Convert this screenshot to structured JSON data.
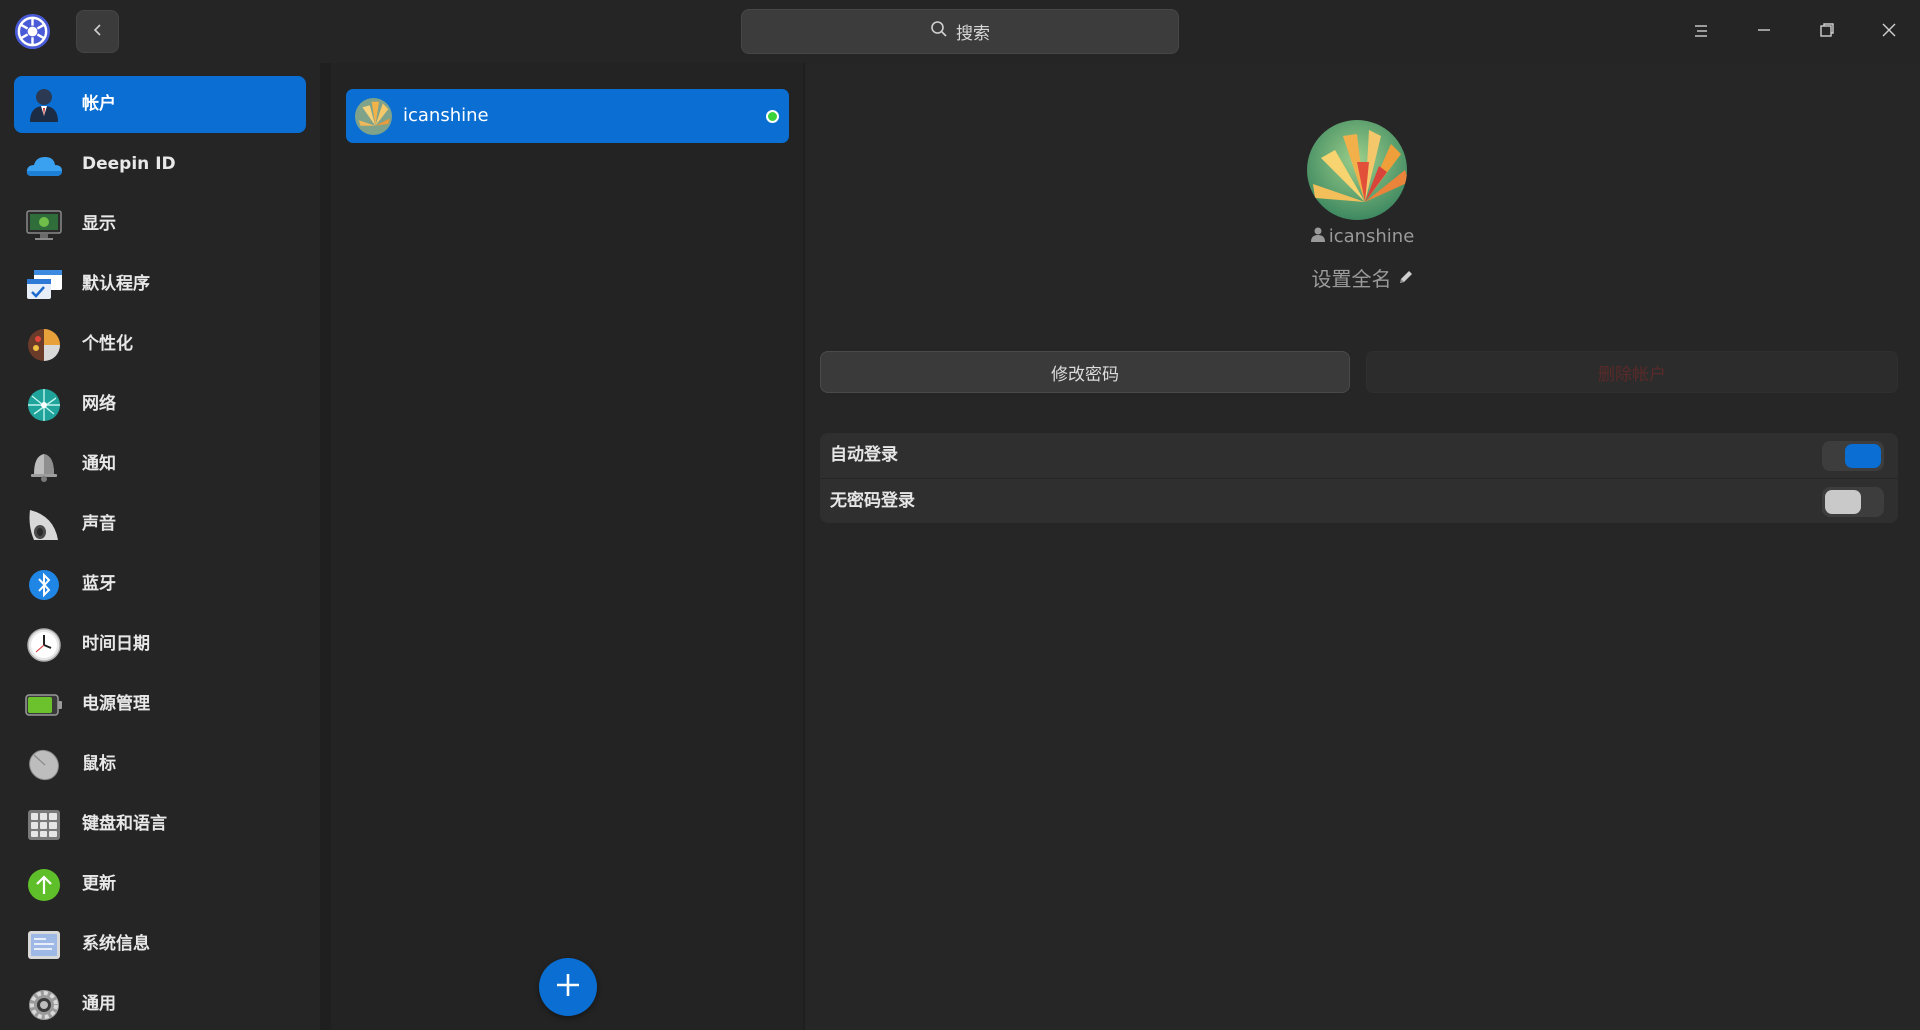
{
  "window": {
    "search_placeholder": "搜索",
    "icons": {
      "app": "settings-gear-icon",
      "back": "chevron-left-icon",
      "search": "search-icon",
      "menu": "menu-icon",
      "minimize": "minimize-icon",
      "maximize": "restore-icon",
      "close": "close-icon"
    }
  },
  "sidebar": {
    "active_index": 0,
    "items": [
      {
        "label": "帐户",
        "icon": "account-icon"
      },
      {
        "label": "Deepin ID",
        "icon": "cloud-icon"
      },
      {
        "label": "显示",
        "icon": "display-icon"
      },
      {
        "label": "默认程序",
        "icon": "default-apps-icon"
      },
      {
        "label": "个性化",
        "icon": "personalization-icon"
      },
      {
        "label": "网络",
        "icon": "network-icon"
      },
      {
        "label": "通知",
        "icon": "bell-icon"
      },
      {
        "label": "声音",
        "icon": "speaker-icon"
      },
      {
        "label": "蓝牙",
        "icon": "bluetooth-icon"
      },
      {
        "label": "时间日期",
        "icon": "clock-icon"
      },
      {
        "label": "电源管理",
        "icon": "battery-icon"
      },
      {
        "label": "鼠标",
        "icon": "mouse-icon"
      },
      {
        "label": "键盘和语言",
        "icon": "keyboard-icon"
      },
      {
        "label": "更新",
        "icon": "update-icon"
      },
      {
        "label": "系统信息",
        "icon": "system-info-icon"
      },
      {
        "label": "通用",
        "icon": "general-gear-icon"
      }
    ]
  },
  "userlist": {
    "users": [
      {
        "name": "icanshine",
        "online": true,
        "selected": true
      }
    ],
    "add_icon": "plus-icon"
  },
  "detail": {
    "username": "icanshine",
    "fullname_placeholder": "设置全名",
    "change_password_label": "修改密码",
    "delete_account_label": "删除帐户",
    "settings": [
      {
        "label": "自动登录",
        "enabled": true
      },
      {
        "label": "无密码登录",
        "enabled": false
      }
    ]
  },
  "colors": {
    "accent": "#0a6ed3",
    "online": "#3cd23c",
    "background": "#1f1f1f"
  }
}
